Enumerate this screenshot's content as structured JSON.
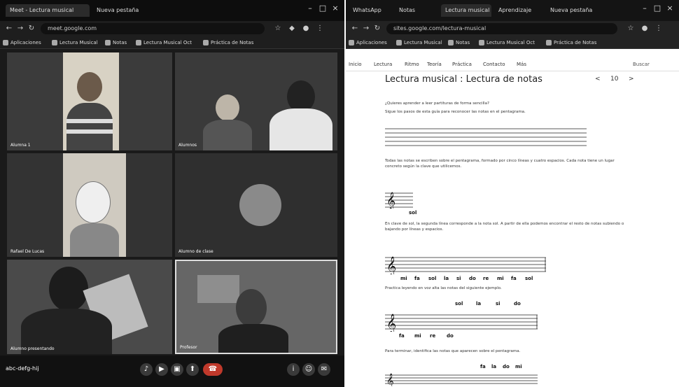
{
  "left_window": {
    "tabs": [
      "Meet - Lectura musical",
      "Nueva pestaña"
    ],
    "url": "meet.google.com",
    "bookmarks": [
      "Aplicaciones",
      "Lectura Musical",
      "Notas",
      "Lectura Musical Oct",
      "Práctica de Notas"
    ],
    "participants": [
      {
        "name": "Alumna 1"
      },
      {
        "name": "Alumnos"
      },
      {
        "name": "Rafael De Lucas"
      },
      {
        "name": "Alumno de clase"
      },
      {
        "name": "Alumno presentando"
      },
      {
        "name": "Profesor"
      }
    ],
    "meet_code": "abc-defg-hij"
  },
  "right_window": {
    "tabs": [
      "WhatsApp",
      "Notas",
      "Lectura musical",
      "Aprendizaje",
      "Nueva pestaña"
    ],
    "url": "sites.google.com/lectura-musical",
    "bookmarks": [
      "Aplicaciones",
      "Lectura Musical",
      "Notas",
      "Lectura Musical Oct",
      "Práctica de Notas"
    ],
    "site_nav": [
      "Inicio",
      "Lectura",
      "Ritmo",
      "Teoría",
      "Práctica",
      "Contacto",
      "Más"
    ],
    "nav_right": "Buscar",
    "title": "Lectura musical : Lectura de notas",
    "pager": [
      "<",
      "10",
      ">"
    ],
    "paragraphs": [
      "¿Quieres aprender a leer partituras de forma sencilla?",
      "Sigue los pasos de esta guía para reconocer las notas en el pentagrama.",
      "Todas las notas se escriben sobre el pentagrama, formado por cinco líneas y cuatro espacios. Cada nota tiene un lugar concreto según la clave que utilicemos.",
      "En clave de sol, la segunda línea corresponde a la nota sol. A partir de ella podemos encontrar el resto de notas subiendo o bajando por líneas y espacios.",
      "Practica leyendo en voz alta las notas del siguiente ejemplo.",
      "Para terminar, identifica las notas que aparecen sobre el pentagrama."
    ],
    "note_labels": {
      "example1": [
        "sol"
      ],
      "example2": [
        "mi",
        "fa",
        "sol",
        "la",
        "si",
        "do",
        "re",
        "mi",
        "fa",
        "sol"
      ],
      "example3_top": [
        "sol",
        "la",
        "si",
        "do"
      ],
      "example3_bottom": [
        "fa",
        "mi",
        "re",
        "do"
      ],
      "example4": [
        "fa",
        "la",
        "do",
        "mi"
      ]
    }
  }
}
